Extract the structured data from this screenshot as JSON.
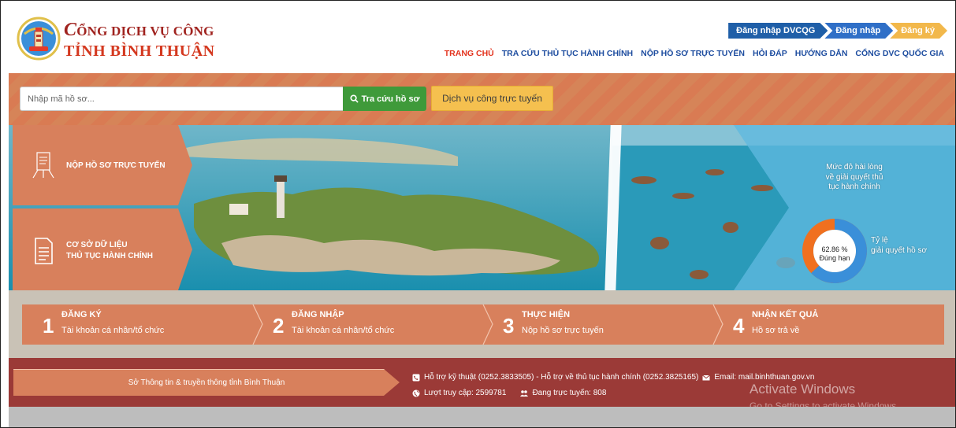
{
  "brand": {
    "line1_first": "C",
    "line1_rest": "ỔNG DỊCH VỤ CÔNG",
    "line2": "TỈNH BÌNH THUẬN"
  },
  "auth": {
    "dvcqg": "Đăng nhập DVCQG",
    "login": "Đăng nhập",
    "register": "Đăng ký"
  },
  "nav": [
    {
      "label": "TRANG CHỦ",
      "active": true
    },
    {
      "label": "TRA CỨU THỦ TỤC HÀNH CHÍNH",
      "active": false
    },
    {
      "label": "NỘP HỒ SƠ TRỰC TUYẾN",
      "active": false
    },
    {
      "label": "HỎI ĐÁP",
      "active": false
    },
    {
      "label": "HƯỚNG DẪN",
      "active": false
    },
    {
      "label": "CỔNG DVC QUỐC GIA",
      "active": false
    }
  ],
  "search": {
    "placeholder": "Nhập mã hồ sơ...",
    "button": "Tra cứu hồ sơ",
    "online_service": "Dịch vụ công trực tuyến"
  },
  "banner": {
    "submit_online": "NỘP HỒ SƠ TRỰC TUYẾN",
    "database_line1": "CƠ SỞ DỮ LIỆU",
    "database_line2": "THỦ TỤC HÀNH CHÍNH",
    "stat_title_1": "Mức độ hài lòng",
    "stat_title_2": "về giải quyết thủ",
    "stat_title_3": "tục hành chính",
    "on_time_percent": "62.86 %",
    "on_time_label": "Đúng hạn",
    "on_time_value": 62.86,
    "ratio_1": "Tỷ lệ",
    "ratio_2": "giải quyết hồ sơ"
  },
  "steps": [
    {
      "num": "1",
      "title": "ĐĂNG KÝ",
      "desc": "Tài khoản cá nhân/tổ chức"
    },
    {
      "num": "2",
      "title": "ĐĂNG NHẬP",
      "desc": "Tài khoản cá nhân/tổ chức"
    },
    {
      "num": "3",
      "title": "THỰC HIỆN",
      "desc": "Nộp hồ sơ trực tuyến"
    },
    {
      "num": "4",
      "title": "NHẬN KẾT QUẢ",
      "desc": "Hồ sơ trả về"
    }
  ],
  "footer": {
    "org": "Sở Thông tin & truyền thông tỉnh Bình Thuận",
    "support": "Hỗ trợ kỹ thuật (0252.3833505) - Hỗ trợ về thủ tục hành chính (0252.3825165)",
    "email": "Email: mail.binhthuan.gov.vn",
    "visits": "Lượt truy cập: 2599781",
    "online": "Đang trực tuyến: 808",
    "activate_title": "Activate Windows",
    "activate_sub": "Go to Settings to activate Windows."
  },
  "colors": {
    "accent": "#d8805c",
    "footer": "#9b3a37",
    "nav": "#1f4ea0",
    "nav_active": "#e3341f",
    "search_green": "#3f9a3a",
    "donut_blue": "#3a8fd9",
    "donut_orange": "#f0701f"
  },
  "icons": [
    "emblem-logo",
    "search-icon",
    "document-stand-icon",
    "document-list-icon",
    "phone-icon",
    "mail-icon",
    "globe-icon",
    "users-icon"
  ]
}
